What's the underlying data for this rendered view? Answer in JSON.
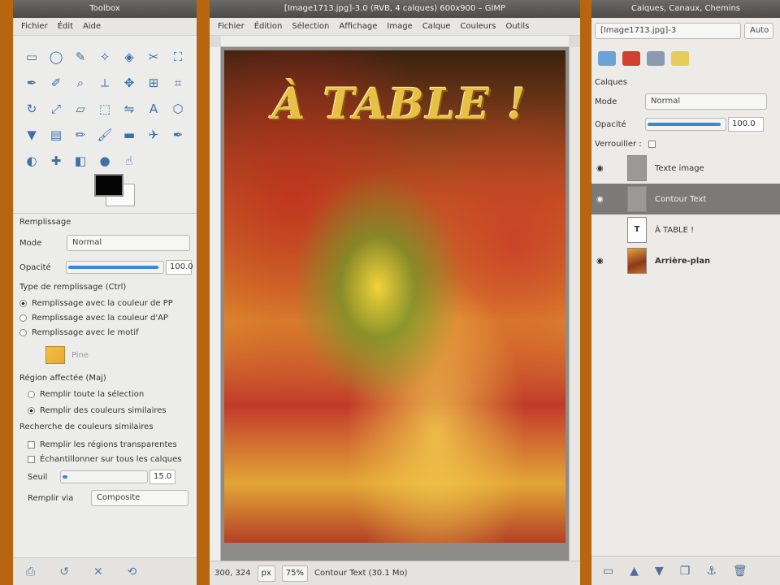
{
  "toolbox": {
    "title": "Toolbox",
    "menu": [
      "Fichier",
      "Édit",
      "Aide"
    ],
    "tool_icons": [
      "rect-select-icon",
      "ellipse-select-icon",
      "free-select-icon",
      "fuzzy-select-icon",
      "color-select-icon",
      "scissors-icon",
      "foreground-select-icon",
      "paths-icon",
      "color-picker-icon",
      "zoom-icon",
      "measure-icon",
      "move-icon",
      "align-icon",
      "crop-icon",
      "rotate-icon",
      "scale-icon",
      "shear-icon",
      "perspective-icon",
      "flip-icon",
      "text-icon",
      "cage-icon",
      "bucket-fill-icon",
      "blend-icon",
      "pencil-icon",
      "paintbrush-icon",
      "eraser-icon",
      "airbrush-icon",
      "ink-icon",
      "clone-icon",
      "heal-icon",
      "perspective-clone-icon",
      "blur-icon",
      "smudge-icon"
    ],
    "options_title": "Remplissage",
    "mode_label": "Mode",
    "mode_value": "Normal",
    "opacity_label": "Opacité",
    "opacity_value": "100.0",
    "opacity_fraction": 0.96,
    "fill_type_title": "Type de remplissage (Ctrl)",
    "fill_type_options": [
      "Remplissage avec la couleur de PP",
      "Remplissage avec la couleur d'AP",
      "Remplissage avec le motif"
    ],
    "fill_type_selected": 0,
    "affected_title": "Région affectée (Maj)",
    "affected_options": [
      "Remplir toute la sélection",
      "Remplir des couleurs similaires"
    ],
    "affected_selected": 1,
    "similar_title": "Recherche de couleurs similaires",
    "similar_checks": [
      "Remplir les régions transparentes",
      "Échantillonner sur tous les calques"
    ],
    "threshold_label": "Seuil",
    "threshold_value": "15.0",
    "threshold_fraction": 0.06,
    "fill_by_label": "Remplir via",
    "fill_by_value": "Composite",
    "pattern_label": "Pine"
  },
  "image": {
    "title": "[Image1713.jpg]-3.0 (RVB, 4 calques) 600x900 – GIMP",
    "menu": [
      "Fichier",
      "Édition",
      "Sélection",
      "Affichage",
      "Image",
      "Calque",
      "Couleurs",
      "Outils"
    ],
    "banner_text": "À TABLE !",
    "coords": "300, 324",
    "unit": "px",
    "zoom": "75%",
    "status": "Contour Text (30.1 Mo)"
  },
  "layers": {
    "title": "Calques, Canaux, Chemins",
    "image_select": "[Image1713.jpg]-3",
    "auto_label": "Auto",
    "tab_label": "Calques",
    "mode_label": "Mode",
    "mode_value": "Normal",
    "opacity_label": "Opacité",
    "opacity_value": "100.0",
    "opacity_fraction": 0.96,
    "lock_label": "Verrouiller :",
    "items": [
      {
        "name": "Texte image",
        "selected": false
      },
      {
        "name": "Contour Text",
        "selected": true
      },
      {
        "name": "À TABLE !",
        "selected": false
      },
      {
        "name": "Arrière-plan",
        "selected": false
      }
    ]
  },
  "colors": {
    "foreground": "#050505",
    "background": "#fafafa",
    "accent": "#3b87d8",
    "selection": "#7b7a76"
  }
}
